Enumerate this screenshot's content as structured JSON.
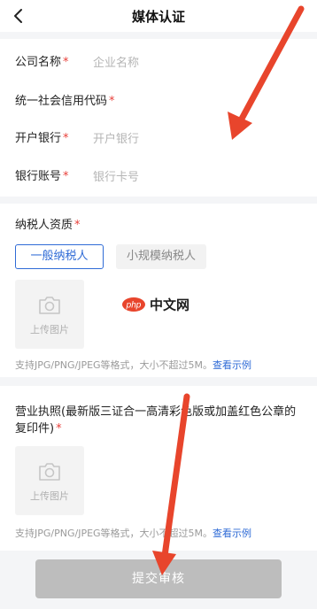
{
  "header": {
    "title": "媒体认证"
  },
  "form": {
    "company_name": {
      "label": "公司名称",
      "required": "*",
      "placeholder": "企业名称"
    },
    "credit_code": {
      "label": "统一社会信用代码",
      "required": "*"
    },
    "bank": {
      "label": "开户银行",
      "required": "*",
      "placeholder": "开户银行"
    },
    "account": {
      "label": "银行账号",
      "required": "*",
      "placeholder": "银行卡号"
    },
    "taxpayer": {
      "label": "纳税人资质",
      "required": "*",
      "options": [
        "一般纳税人",
        "小规模纳税人"
      ],
      "selected": "一般纳税人",
      "upload_label": "上传图片",
      "hint": "支持JPG/PNG/JPEG等格式，大小不超过5M。",
      "hint_link": "查看示例"
    },
    "license": {
      "label": "营业执照(最新版三证合一高清彩色版或加盖红色公章的复印件)",
      "required": "*",
      "upload_label": "上传图片",
      "hint": "支持JPG/PNG/JPEG等格式，大小不超过5M。",
      "hint_link": "查看示例"
    }
  },
  "watermark": {
    "brand": "php",
    "text": "中文网"
  },
  "submit": {
    "label": "提交审核"
  },
  "colors": {
    "accent": "#2f6bd6",
    "required": "#e8403a",
    "annotation_arrow": "#e8452c",
    "submit_disabled": "#bdbdbd"
  },
  "icons": [
    "chevron-left-icon",
    "camera-icon",
    "red-arrow-annotation"
  ]
}
